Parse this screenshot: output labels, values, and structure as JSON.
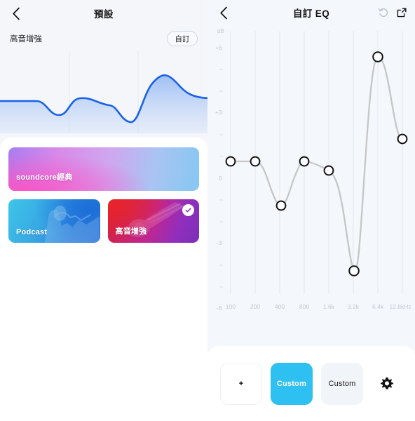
{
  "left": {
    "header": {
      "title": "預設",
      "back_icon": "chevron-left-icon"
    },
    "subrow": {
      "preset_name": "高音增強",
      "custom_pill": "自訂"
    },
    "preview_chart": {
      "type": "area",
      "line_color": "#1a62e8",
      "fill_from": "#8fb5f2",
      "points_db": [
        0,
        0,
        -1.3,
        0,
        -0.6,
        -3.5,
        5.0,
        2.2
      ]
    },
    "cards": [
      {
        "title": "soundcore經典",
        "selected": false,
        "style": "classic"
      },
      {
        "title": "Podcast",
        "selected": false,
        "style": "podcast"
      },
      {
        "title": "高音增強",
        "selected": true,
        "style": "treble"
      }
    ]
  },
  "right": {
    "header": {
      "title": "自訂 EQ",
      "back_icon": "chevron-left-icon",
      "reset_icon": "reset-icon",
      "share_icon": "share-export-icon"
    },
    "bottom": {
      "add_label": "+",
      "presets": [
        {
          "label": "Custom",
          "active": true
        },
        {
          "label": "Custom",
          "active": false
        }
      ],
      "settings_icon": "gear-icon",
      "active_color": "#2ec0f0"
    },
    "chart_data": {
      "type": "line",
      "title": "自訂 EQ",
      "ylabel": "dB",
      "xlabel": "",
      "grid": true,
      "legend": "none",
      "line_color": "#c8c8c8",
      "node_color": "#111111",
      "ylim": [
        -6,
        6
      ],
      "yticks": [
        6,
        3,
        0,
        -3,
        -6
      ],
      "ytick_labels": [
        "+6",
        "+3",
        "0",
        "-3",
        "-6"
      ],
      "yminor_ticks": [
        5,
        4,
        2,
        1,
        -1,
        -2,
        -4,
        -5
      ],
      "categories": [
        "100",
        "200",
        "400",
        "800",
        "1.6k",
        "3.2k",
        "6.4k",
        "12.8kHz"
      ],
      "values": [
        0,
        0,
        -1.3,
        0,
        -0.6,
        -3.5,
        5.0,
        2.2
      ]
    }
  }
}
